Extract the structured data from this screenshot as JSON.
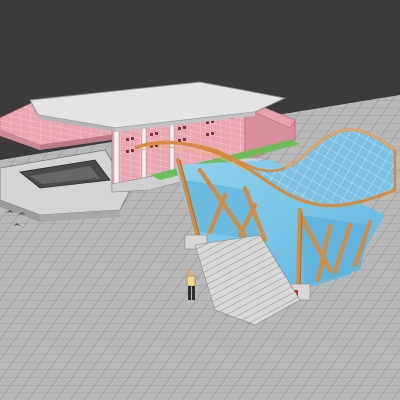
{
  "viewport": {
    "background_color": "#3b3b3b",
    "ground_color": "#b9b9b9",
    "grid_line_color": "#7d7d7d"
  },
  "building": {
    "roof_color": "#e2e2e2",
    "wall_color": "#e8a2ad",
    "base_color": "#cfcfcf",
    "window_color": "#8c3b48"
  },
  "canopy": {
    "glass_color": "#6fb6dc",
    "glass_highlight": "#a9d8f0",
    "frame_color": "#d98a3a",
    "water_color": "#72c6e8"
  },
  "lawn_color": "#6bbf5a",
  "icons": [
    "person-figure",
    "bird-icon"
  ]
}
